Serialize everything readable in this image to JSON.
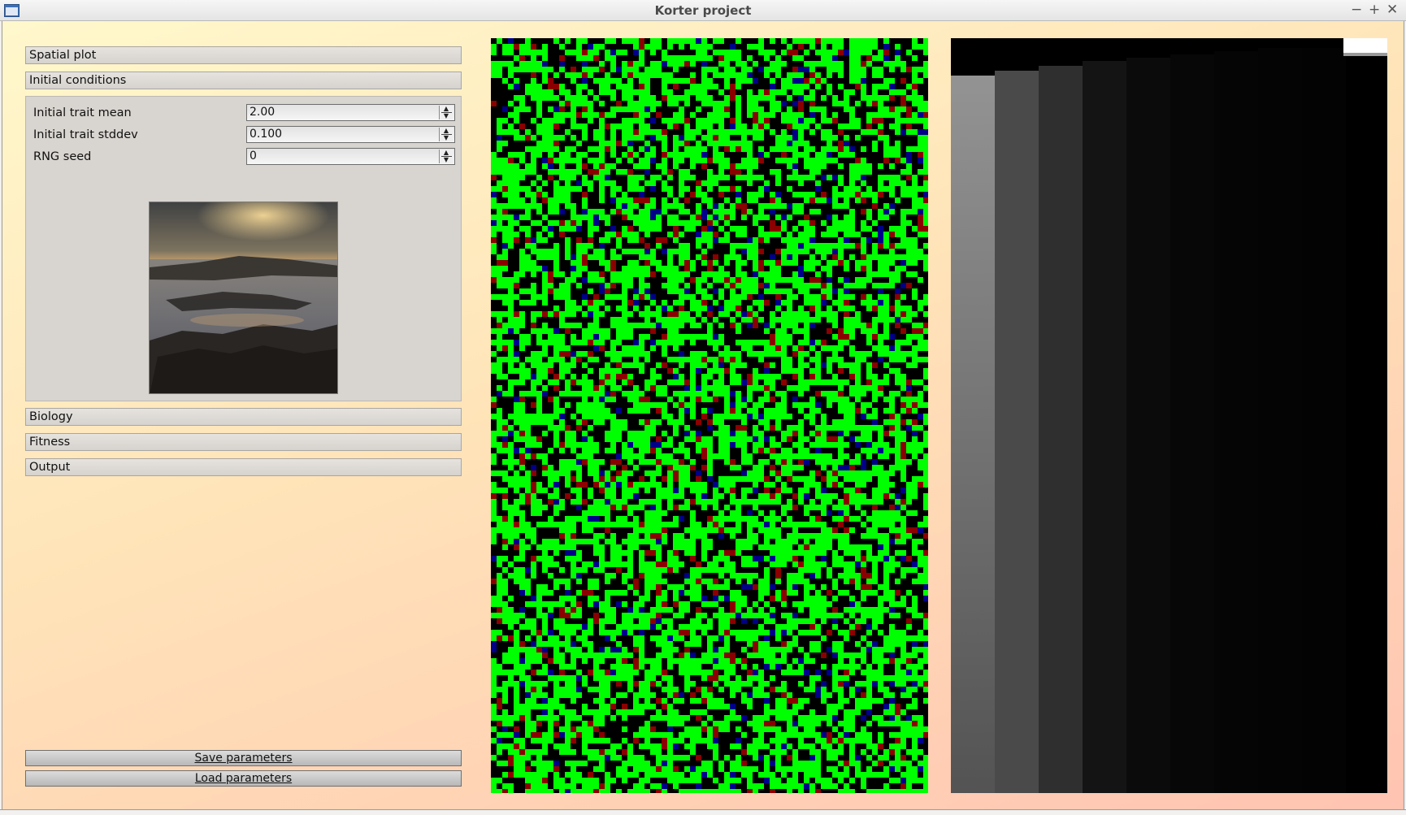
{
  "window": {
    "title": "Korter project",
    "controls": {
      "minimize": "−",
      "maximize": "+",
      "close": "✕"
    }
  },
  "sidebar": {
    "sections": [
      {
        "label": "Spatial plot",
        "expanded": false
      },
      {
        "label": "Initial conditions",
        "expanded": true
      },
      {
        "label": "Biology",
        "expanded": false
      },
      {
        "label": "Fitness",
        "expanded": false
      },
      {
        "label": "Output",
        "expanded": false
      }
    ],
    "initial_conditions": {
      "params": [
        {
          "label": "Initial trait mean",
          "value": "2.00"
        },
        {
          "label": "Initial trait stddev",
          "value": "0.100"
        },
        {
          "label": "RNG seed",
          "value": "0"
        }
      ],
      "image": "coastal-rocks-sunset-photo"
    },
    "buttons": {
      "save": "Save parameters",
      "load": "Load parameters"
    }
  },
  "plots": {
    "spatial": {
      "colors": [
        "#00ff00",
        "#000000",
        "#8b0000",
        "#000088"
      ]
    },
    "history": {
      "colors": [
        "#ffffff",
        "#000000",
        "#808080"
      ]
    }
  }
}
